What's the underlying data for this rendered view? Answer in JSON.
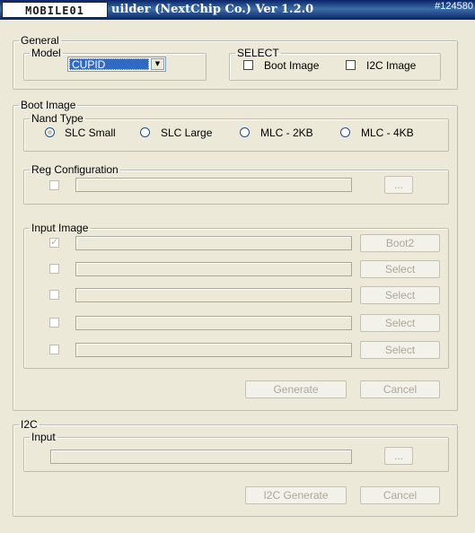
{
  "window": {
    "logo_text": "MOBILE01",
    "title": "uilder (NextChip Co.) Ver 1.2.0",
    "watermark": "#124580"
  },
  "general": {
    "legend": "General",
    "model": {
      "legend": "Model",
      "selected": "CUPID"
    },
    "select": {
      "legend": "SELECT",
      "boot_image_label": "Boot Image",
      "i2c_image_label": "I2C Image"
    }
  },
  "boot_image": {
    "legend": "Boot Image",
    "nand_type": {
      "legend": "Nand Type",
      "options": [
        "SLC Small",
        "SLC Large",
        "MLC - 2KB",
        "MLC - 4KB"
      ],
      "selected": "SLC Small"
    },
    "reg_config": {
      "legend": "Reg Configuration",
      "browse_label": "..."
    },
    "input_image": {
      "legend": "Input Image",
      "rows": [
        {
          "checked": true,
          "button": "Boot2"
        },
        {
          "checked": false,
          "button": "Select"
        },
        {
          "checked": false,
          "button": "Select"
        },
        {
          "checked": false,
          "button": "Select"
        },
        {
          "checked": false,
          "button": "Select"
        }
      ]
    },
    "generate_label": "Generate",
    "cancel_label": "Cancel"
  },
  "i2c": {
    "legend": "I2C",
    "input_legend": "Input",
    "browse_label": "...",
    "generate_label": "I2C Generate",
    "cancel_label": "Cancel"
  }
}
